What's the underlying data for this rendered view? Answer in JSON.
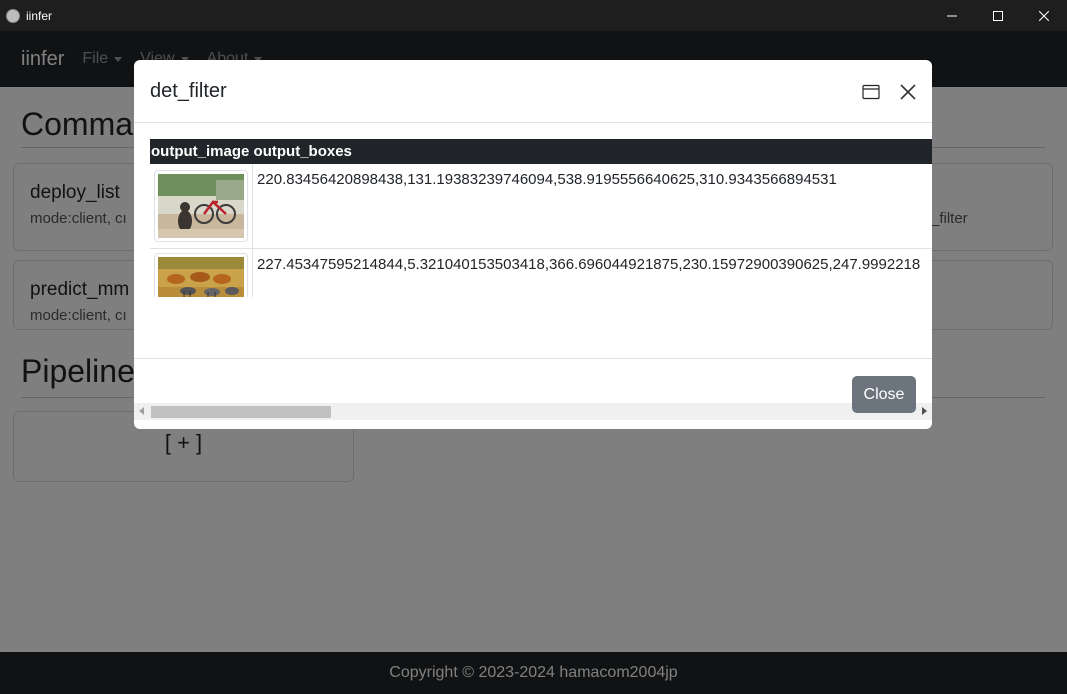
{
  "window": {
    "title": "iinfer"
  },
  "navbar": {
    "brand": "iinfer",
    "menus": [
      {
        "label": "File"
      },
      {
        "label": "View"
      },
      {
        "label": "About"
      }
    ]
  },
  "page": {
    "commands_heading": "Comman",
    "pipeline_heading": "Pipeline",
    "cards": [
      {
        "title": "deploy_list",
        "subtitle": "mode:client, cı"
      },
      {
        "title": "predict_mm",
        "subtitle": "mode:client, cı"
      }
    ],
    "right_card_text": "_filter",
    "add_button": "[ + ]"
  },
  "footer": {
    "copyright": "Copyright © 2023-2024 hamacom2004jp"
  },
  "modal": {
    "title": "det_filter",
    "table": {
      "columns": [
        "output_image",
        "output_boxes"
      ],
      "rows": [
        {
          "image": "cat-bicycle-thumbnail",
          "boxes": "220.83456420898438,131.19383239746094,538.9195556640625,310.9343566894531"
        },
        {
          "image": "animals-field-thumbnail",
          "boxes": "227.45347595214844,5.321040153503418,366.696044921875,230.15972900390625,247.9992218"
        }
      ]
    },
    "close_label": "Close"
  }
}
